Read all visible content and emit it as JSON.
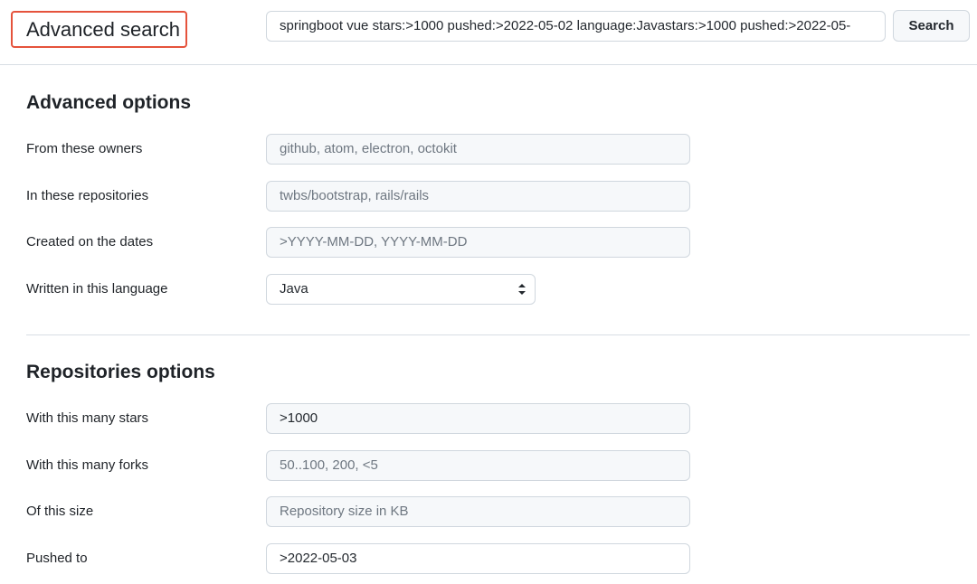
{
  "header": {
    "title": "Advanced search",
    "query": "springboot vue  stars:>1000 pushed:>2022-05-02 language:Javastars:>1000 pushed:>2022-05-",
    "search_button": "Search"
  },
  "advanced_options": {
    "title": "Advanced options",
    "owners": {
      "label": "From these owners",
      "placeholder": "github, atom, electron, octokit"
    },
    "repositories": {
      "label": "In these repositories",
      "placeholder": "twbs/bootstrap, rails/rails"
    },
    "dates": {
      "label": "Created on the dates",
      "placeholder": ">YYYY-MM-DD, YYYY-MM-DD"
    },
    "language": {
      "label": "Written in this language",
      "value": "Java"
    }
  },
  "repositories_options": {
    "title": "Repositories options",
    "stars": {
      "label": "With this many stars",
      "value": ">1000"
    },
    "forks": {
      "label": "With this many forks",
      "placeholder": "50..100, 200, <5"
    },
    "size": {
      "label": "Of this size",
      "placeholder": "Repository size in KB"
    },
    "pushed": {
      "label": "Pushed to",
      "value": ">2022-05-03"
    }
  },
  "icons": {
    "language_select_caret": "chevron-up-down-icon"
  }
}
